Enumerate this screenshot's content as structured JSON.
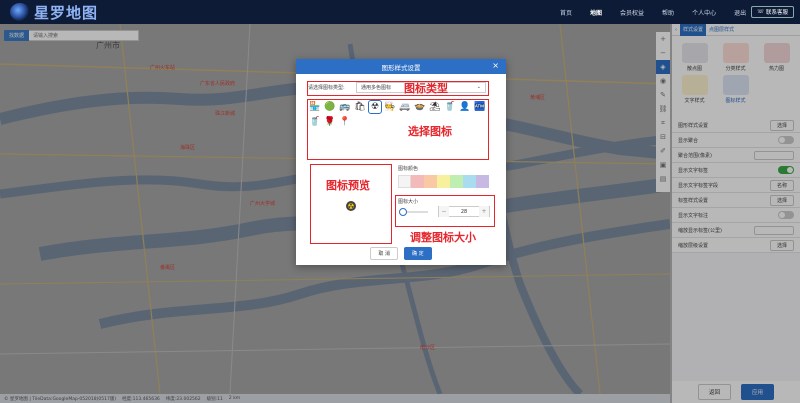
{
  "header": {
    "logo_text": "星罗地图",
    "nav": [
      "首页",
      "地图",
      "会员权益",
      "帮助",
      "个人中心",
      "退出"
    ],
    "active_nav": 1,
    "contact": "联系客服"
  },
  "map": {
    "search_category": "找数据",
    "search_placeholder": "请输入搜索",
    "city_label": "广州市",
    "labels": [
      "广州火车站",
      "广东省人民政府",
      "珠江新城",
      "海珠区",
      "番禺区",
      "黄埔区",
      "广州大学城",
      "南沙区"
    ]
  },
  "statusbar": {
    "text": "© 星罗地图 | TileData:GoogleMap-052018(0517版)",
    "lng": "经度:113.465636",
    "lat": "纬度:23.002562",
    "zoom": "级别:11",
    "scale": "2 km"
  },
  "panel": {
    "tabs": [
      "样式设置",
      "点图层样式"
    ],
    "styles": [
      {
        "label": "散点图",
        "color": "#e8e8ee"
      },
      {
        "label": "分类样式",
        "color": "#ffe0d8"
      },
      {
        "label": "热力图",
        "color": "#f4d8d8"
      },
      {
        "label": "文字样式",
        "color": "#fff4d0"
      },
      {
        "label": "图标样式",
        "color": "#dde6f6"
      }
    ],
    "rows": [
      {
        "label": "图形样式设置",
        "button": "选择"
      },
      {
        "label": "显示聚合",
        "toggle": false
      },
      {
        "label": "聚合范围(像素)",
        "value": ""
      },
      {
        "label": "显示文字标签",
        "toggle": true
      },
      {
        "label": "显示文字标签字段",
        "button": "名称"
      },
      {
        "label": "标签样式设置",
        "button": "选择"
      },
      {
        "label": "显示文字标注",
        "toggle": false
      },
      {
        "label": "缩放显示标签(公里)",
        "value": ""
      },
      {
        "label": "缩放层级设置",
        "button": "选择"
      }
    ],
    "cancel": "返回",
    "apply": "应用"
  },
  "modal": {
    "title": "图形样式设置",
    "type_label": "请选择图标类型:",
    "type_value": "通用多色图标",
    "icons": [
      "🏪",
      "🟢",
      "🚌",
      "🛍",
      "☢",
      "🧑‍🍳",
      "🚐",
      "🍲",
      "⛱",
      "🥤",
      "👤",
      "🏧",
      "🥤",
      "🌹",
      "📍"
    ],
    "selected_icon": 4,
    "preview_icon": "☢",
    "color_title": "图标颜色",
    "colors": [
      "#f4f4f4",
      "#f4b9b9",
      "#f8c9a4",
      "#f7f19e",
      "#bfeeb0",
      "#a9dcef",
      "#c8b8e4"
    ],
    "size_title": "图标大小",
    "size_value": "28",
    "size_fraction": 0.12,
    "cancel": "取 消",
    "confirm": "确 定"
  },
  "annotations": {
    "type": "图标类型",
    "select": "选择图标",
    "preview": "图标预览",
    "size": "调整图标大小"
  },
  "colors": {
    "nav_bg": "#0d1b36",
    "accent": "#2d6fc4",
    "annotation": "#e5262c"
  }
}
